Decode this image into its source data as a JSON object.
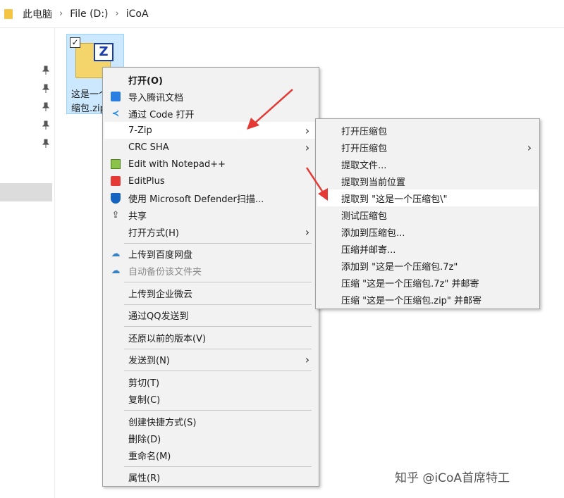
{
  "address_bar": {
    "segments": [
      "此电脑",
      "File (D:)",
      "iCoA"
    ]
  },
  "file": {
    "name_line1": "这是一个",
    "name_line2": "缩包.zip",
    "checked": "✓",
    "badge": "Z"
  },
  "context_menu": {
    "items": [
      {
        "label": "打开(O)"
      },
      {
        "label": "导入腾讯文档"
      },
      {
        "label": "通过 Code 打开"
      },
      {
        "label": "7-Zip"
      },
      {
        "label": "CRC SHA"
      },
      {
        "label": "Edit with Notepad++"
      },
      {
        "label": "EditPlus"
      },
      {
        "label": "使用 Microsoft Defender扫描..."
      },
      {
        "label": "共享"
      },
      {
        "label": "打开方式(H)"
      },
      {
        "label": "上传到百度网盘"
      },
      {
        "label": "自动备份该文件夹"
      },
      {
        "label": "上传到企业微云"
      },
      {
        "label": "通过QQ发送到"
      },
      {
        "label": "还原以前的版本(V)"
      },
      {
        "label": "发送到(N)"
      },
      {
        "label": "剪切(T)"
      },
      {
        "label": "复制(C)"
      },
      {
        "label": "创建快捷方式(S)"
      },
      {
        "label": "删除(D)"
      },
      {
        "label": "重命名(M)"
      },
      {
        "label": "属性(R)"
      }
    ],
    "highlighted": "7-Zip"
  },
  "submenu_7zip": {
    "items": [
      {
        "label": "打开压缩包"
      },
      {
        "label": "打开压缩包"
      },
      {
        "label": "提取文件..."
      },
      {
        "label": "提取到当前位置"
      },
      {
        "label": "提取到 \"这是一个压缩包\\\""
      },
      {
        "label": "测试压缩包"
      },
      {
        "label": "添加到压缩包..."
      },
      {
        "label": "压缩并邮寄..."
      },
      {
        "label": "添加到 \"这是一个压缩包.7z\""
      },
      {
        "label": "压缩 \"这是一个压缩包.7z\" 并邮寄"
      },
      {
        "label": "压缩 \"这是一个压缩包.zip\" 并邮寄"
      }
    ],
    "highlighted": "提取到 \"这是一个压缩包\\\""
  },
  "watermark": "知乎 @iCoA首席特工",
  "icons": {
    "chevron": "›",
    "pin": "📌",
    "submenu_arrow": "〉"
  },
  "colors": {
    "annotation_arrow": "#e53935",
    "selection_bg": "#cce8ff",
    "menu_bg": "#f2f2f2"
  }
}
